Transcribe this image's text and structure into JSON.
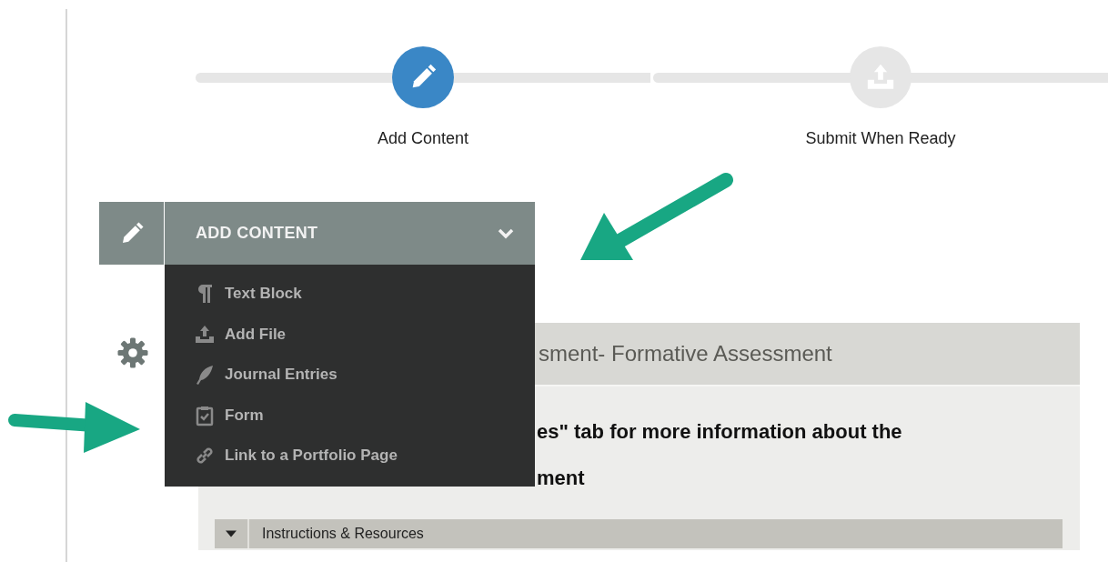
{
  "steps": [
    {
      "label": "Add Content",
      "kind": "pencil",
      "active": true
    },
    {
      "label": "Submit When Ready",
      "kind": "upload",
      "active": false
    }
  ],
  "add_content_menu": {
    "title": "ADD CONTENT",
    "expanded": true,
    "items": [
      {
        "label": "Text Block",
        "kind": "paragraph"
      },
      {
        "label": "Add File",
        "kind": "upload"
      },
      {
        "label": "Journal Entries",
        "kind": "feather"
      },
      {
        "label": "Form",
        "kind": "clipboard"
      },
      {
        "label": "Link to a Portfolio Page",
        "kind": "link"
      }
    ]
  },
  "panel": {
    "title": "sment- Formative Assessment",
    "body_lines": [
      "es\" tab for more information about the",
      "ment"
    ],
    "section": {
      "label": "Instructions & Resources"
    }
  }
}
